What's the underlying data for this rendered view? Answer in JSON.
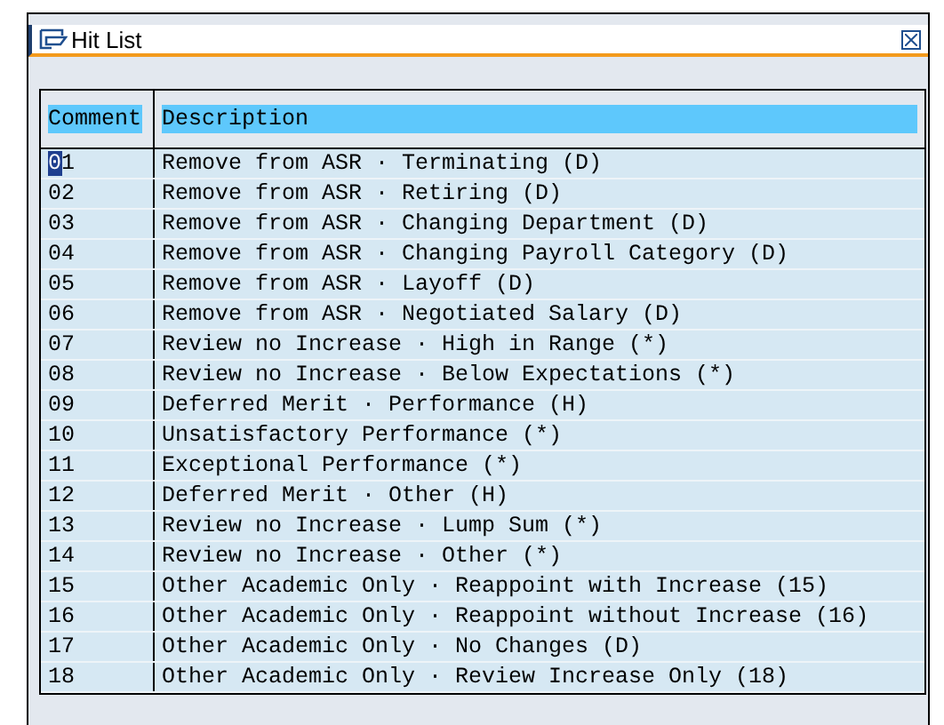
{
  "window": {
    "title": "Hit List"
  },
  "table": {
    "columns": [
      "Comment",
      "Description"
    ],
    "rows": [
      {
        "comment": "01",
        "description": "Remove from ASR · Terminating (D)",
        "focused": true
      },
      {
        "comment": "02",
        "description": "Remove from ASR · Retiring (D)",
        "focused": false
      },
      {
        "comment": "03",
        "description": "Remove from ASR · Changing Department (D)",
        "focused": false
      },
      {
        "comment": "04",
        "description": "Remove from ASR · Changing Payroll Category (D)",
        "focused": false
      },
      {
        "comment": "05",
        "description": "Remove from ASR · Layoff (D)",
        "focused": false
      },
      {
        "comment": "06",
        "description": "Remove from ASR · Negotiated Salary (D)",
        "focused": false
      },
      {
        "comment": "07",
        "description": "Review no Increase · High in Range (*)",
        "focused": false
      },
      {
        "comment": "08",
        "description": "Review no Increase · Below Expectations (*)",
        "focused": false
      },
      {
        "comment": "09",
        "description": "Deferred Merit · Performance (H)",
        "focused": false
      },
      {
        "comment": "10",
        "description": "Unsatisfactory Performance (*)",
        "focused": false
      },
      {
        "comment": "11",
        "description": "Exceptional Performance (*)",
        "focused": false
      },
      {
        "comment": "12",
        "description": "Deferred Merit · Other (H)",
        "focused": false
      },
      {
        "comment": "13",
        "description": "Review no Increase · Lump Sum (*)",
        "focused": false
      },
      {
        "comment": "14",
        "description": "Review no Increase · Other (*)",
        "focused": false
      },
      {
        "comment": "15",
        "description": "Other Academic Only · Reappoint with Increase (15)",
        "focused": false
      },
      {
        "comment": "16",
        "description": "Other Academic Only · Reappoint without Increase (16)",
        "focused": false
      },
      {
        "comment": "17",
        "description": "Other Academic Only · No Changes (D)",
        "focused": false
      },
      {
        "comment": "18",
        "description": "Other Academic Only · Review Increase Only (18)",
        "focused": false
      }
    ]
  }
}
